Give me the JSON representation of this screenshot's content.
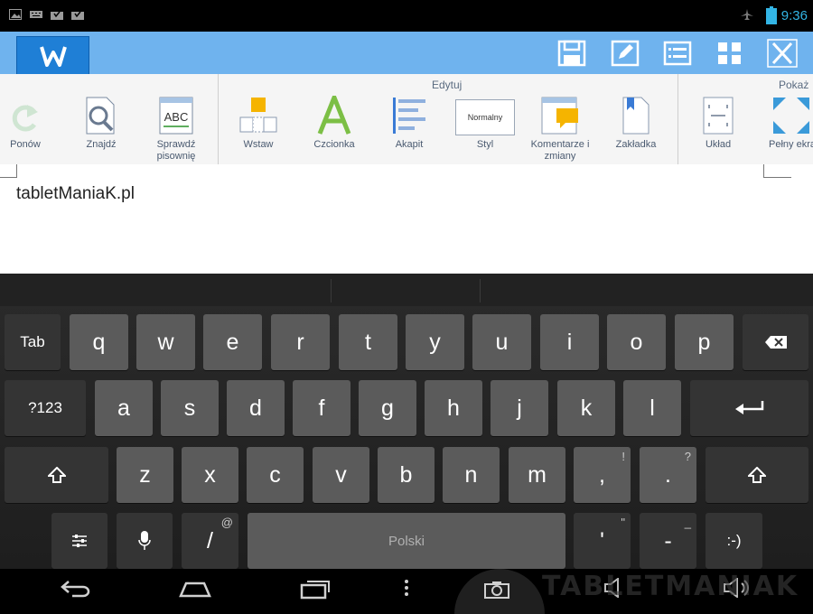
{
  "status_bar": {
    "time": "9:36"
  },
  "document": {
    "text": "tabletManiaK.pl"
  },
  "ribbon": {
    "groups": {
      "edit": "Edytuj",
      "show": "Pokaż"
    },
    "items": {
      "redo": "Ponów",
      "find": "Znajdź",
      "spell": "Sprawdź pisownię",
      "insert": "Wstaw",
      "font": "Czcionka",
      "paragraph": "Akapit",
      "style": "Styl",
      "style_preview": "Normalny",
      "comments": "Komentarze i zmiany",
      "bookmark": "Zakładka",
      "layout": "Układ",
      "fullscreen": "Pełny ekra"
    }
  },
  "keyboard": {
    "row1": [
      "q",
      "w",
      "e",
      "r",
      "t",
      "y",
      "u",
      "i",
      "o",
      "p"
    ],
    "row2": [
      "a",
      "s",
      "d",
      "f",
      "g",
      "h",
      "j",
      "k",
      "l"
    ],
    "row3": [
      "z",
      "x",
      "c",
      "v",
      "b",
      "n",
      "m"
    ],
    "tab": "Tab",
    "sym": "?123",
    "comma": ",",
    "comma_hint": "!",
    "period": ".",
    "period_hint": "?",
    "slash": "/",
    "slash_hint": "@",
    "space": "Polski",
    "apostrophe": "'",
    "apostrophe_hint": "\"",
    "dash": "-",
    "dash_hint": "_",
    "smiley": ":-)"
  },
  "watermark": "TABLETMANIAK",
  "colors": {
    "titlebar": "#6fb3ee",
    "accent": "#33b5e5",
    "logo": "#1f7fd6"
  }
}
